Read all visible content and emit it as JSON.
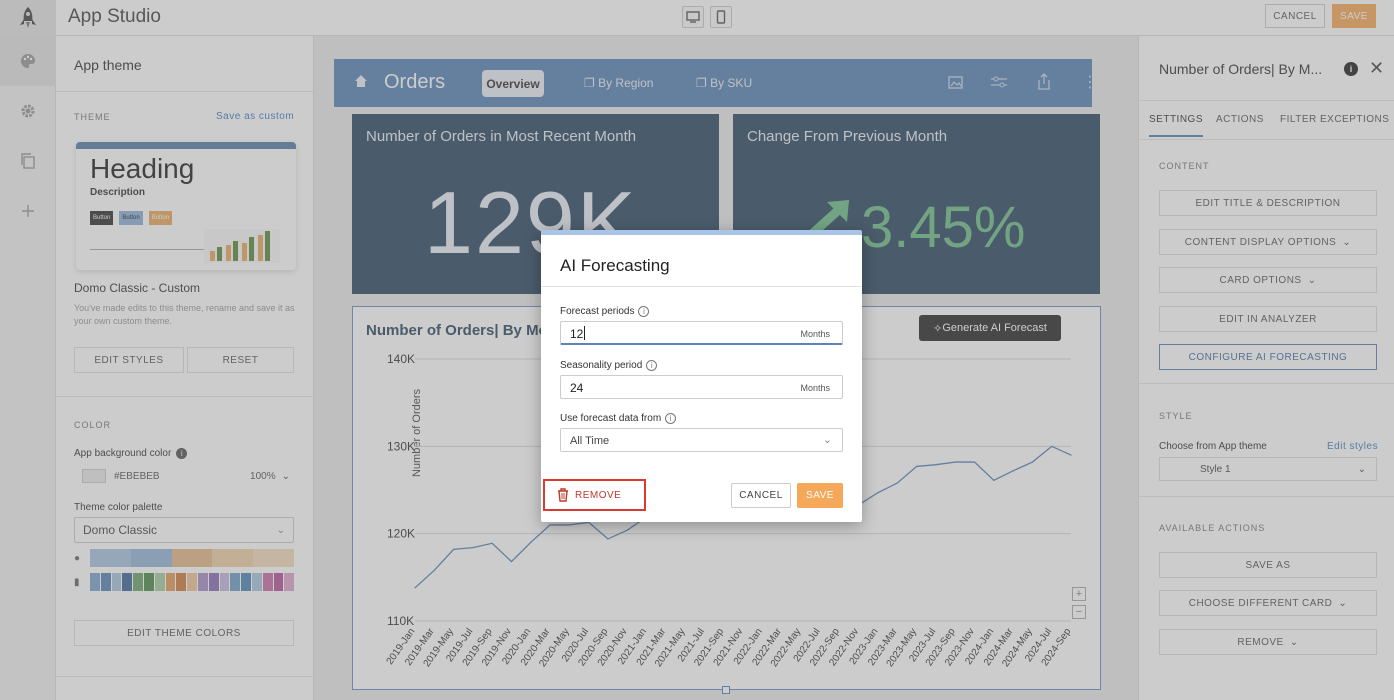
{
  "header": {
    "app_title": "App Studio",
    "cancel_label": "CANCEL",
    "save_label": "SAVE"
  },
  "left_panel": {
    "title": "App theme",
    "theme_label": "THEME",
    "save_as_custom": "Save as custom",
    "preview": {
      "heading": "Heading",
      "description": "Description",
      "buttons": [
        "Button",
        "Button",
        "Button"
      ]
    },
    "theme_name": "Domo Classic - Custom",
    "theme_note": "You've made edits to this theme, rename and save it as your own custom theme.",
    "edit_styles": "EDIT STYLES",
    "reset": "RESET",
    "color_label": "COLOR",
    "bg_color_label": "App background color",
    "bg_color_value": "#EBEBEB",
    "bg_opacity": "100%",
    "palette_label": "Theme color palette",
    "palette_value": "Domo Classic",
    "edit_theme_colors": "EDIT THEME COLORS"
  },
  "navbar": {
    "title": "Orders",
    "tabs": [
      "Overview",
      "By Region",
      "By SKU"
    ]
  },
  "kpis": [
    {
      "title": "Number of Orders in Most Recent Month",
      "value": "129K"
    },
    {
      "title": "Change From Previous Month",
      "value": "3.45%"
    }
  ],
  "chart_card": {
    "title": "Number of Orders| By Mo",
    "generate_button": "Generate AI Forecast"
  },
  "chart_data": {
    "type": "line",
    "ylabel": "Number of Orders",
    "y_ticks": [
      "140K",
      "130K",
      "120K",
      "110K"
    ],
    "ylim": [
      110000,
      140000
    ],
    "x": [
      "2019-Jan",
      "2019-Mar",
      "2019-May",
      "2019-Jul",
      "2019-Sep",
      "2019-Nov",
      "2020-Jan",
      "2020-Mar",
      "2020-May",
      "2020-Jul",
      "2020-Sep",
      "2020-Nov",
      "2021-Jan",
      "2021-Mar",
      "2021-May",
      "2021-Jul",
      "2021-Sep",
      "2021-Nov",
      "2022-Jan",
      "2022-Mar",
      "2022-May",
      "2022-Jul",
      "2022-Sep",
      "2022-Nov",
      "2023-Jan",
      "2023-Mar",
      "2023-May",
      "2023-Jul",
      "2023-Sep",
      "2023-Nov",
      "2024-Jan",
      "2024-Mar",
      "2024-May",
      "2024-Jul",
      "2024-Sep"
    ],
    "series": [
      {
        "values": [
          113800,
          115800,
          118200,
          118400,
          118900,
          116800,
          119000,
          121000,
          121000,
          121300,
          119400,
          120400,
          121900,
          122600,
          123400,
          124000,
          124900,
          125600,
          126000,
          126300,
          126500,
          126400,
          126200,
          123300,
          124700,
          125800,
          127700,
          127900,
          128200,
          128200,
          126100,
          127200,
          128200,
          130000,
          129000
        ]
      }
    ]
  },
  "modal": {
    "title": "AI Forecasting",
    "forecast_label": "Forecast periods",
    "forecast_value": "12",
    "forecast_unit": "Months",
    "season_label": "Seasonality period",
    "season_value": "24",
    "season_unit": "Months",
    "source_label": "Use forecast data from",
    "source_value": "All Time",
    "remove": "REMOVE",
    "cancel": "CANCEL",
    "save": "SAVE"
  },
  "right_panel": {
    "title": "Number of Orders| By M...",
    "tabs": [
      "SETTINGS",
      "ACTIONS",
      "FILTER EXCEPTIONS"
    ],
    "content_label": "CONTENT",
    "buttons": [
      "EDIT TITLE & DESCRIPTION",
      "CONTENT DISPLAY OPTIONS",
      "CARD OPTIONS",
      "EDIT IN ANALYZER",
      "CONFIGURE AI FORECASTING"
    ],
    "style_label": "STYLE",
    "style_choose": "Choose from App theme",
    "edit_styles": "Edit styles",
    "style_value": "Style 1",
    "actions_label": "AVAILABLE ACTIONS",
    "action_buttons": [
      "SAVE AS",
      "CHOOSE DIFFERENT CARD",
      "REMOVE"
    ]
  },
  "colors": {
    "navbar": "#5a84b6",
    "kpi_bg": "#2e4a63",
    "save_orange": "#f5a85a",
    "remove_red": "#c0392b",
    "link_blue": "#3f7fbf"
  }
}
